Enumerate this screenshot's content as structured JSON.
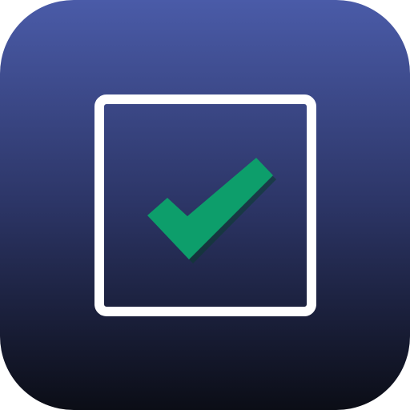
{
  "app_icon": {
    "icon": "checkbox-checked-icon",
    "checked": true,
    "colors": {
      "background_top": "#4a5ba8",
      "background_mid": "#2c3566",
      "background_bottom": "#0b0d16",
      "frame": "#ffffff",
      "check": "#0d9e6b",
      "check_shadow": "#0a3c2b"
    }
  }
}
